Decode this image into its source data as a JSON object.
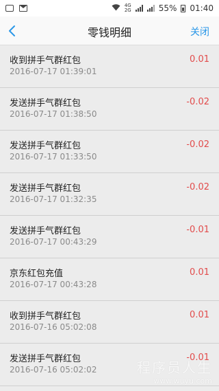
{
  "status_bar": {
    "battery_percent": "55%",
    "time": "01:40",
    "network_top": "4G",
    "network_bottom": "2G",
    "icons": [
      "image-icon",
      "mail-icon",
      "wifi-icon",
      "signal-icon",
      "signal-icon",
      "battery-icon"
    ]
  },
  "nav": {
    "title": "零钱明细",
    "close_label": "关闭",
    "accent": "#2a97e8"
  },
  "transactions": [
    {
      "title": "收到拼手气群红包",
      "date": "2016-07-17 01:39:01",
      "amount": "0.01"
    },
    {
      "title": "发送拼手气群红包",
      "date": "2016-07-17 01:38:50",
      "amount": "-0.02"
    },
    {
      "title": "发送拼手气群红包",
      "date": "2016-07-17 01:33:50",
      "amount": "-0.02"
    },
    {
      "title": "发送拼手气群红包",
      "date": "2016-07-17 01:32:35",
      "amount": "-0.02"
    },
    {
      "title": "发送拼手气群红包",
      "date": "2016-07-17 00:43:29",
      "amount": "-0.01"
    },
    {
      "title": "京东红包充值",
      "date": "2016-07-17 00:43:28",
      "amount": "0.01"
    },
    {
      "title": "收到拼手气群红包",
      "date": "2016-07-16 05:02:08",
      "amount": "0.01"
    },
    {
      "title": "发送拼手气群红包",
      "date": "2016-07-16 05:02:02",
      "amount": "-0.01"
    }
  ],
  "amount_color": "#e24b4b",
  "watermark": {
    "title": "程序员人生",
    "url": "www.wuyu.com"
  }
}
